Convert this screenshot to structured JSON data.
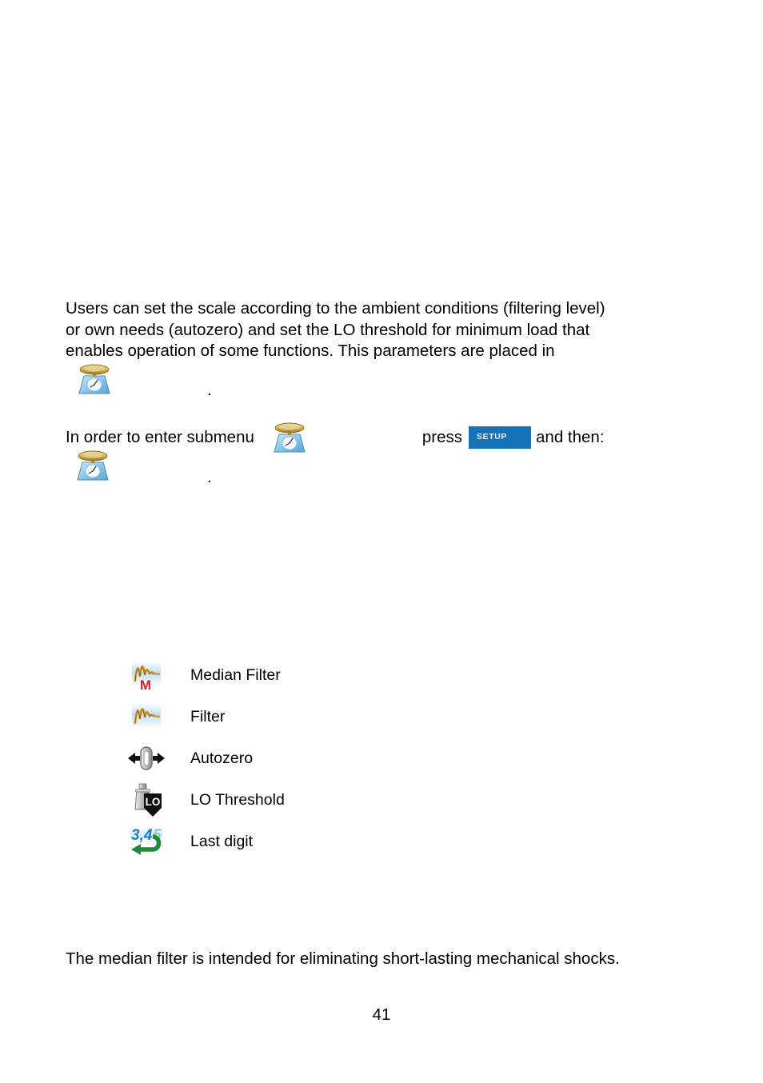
{
  "document": {
    "page_number": "41",
    "intro_paragraph": {
      "line1": "Users can set the scale according to the ambient conditions (filtering level)",
      "line2": "or own needs (autozero) and set the LO threshold for minimum load that",
      "line3": "enables operation of some functions. This parameters are placed in",
      "trailing_period": "."
    },
    "submenu_instruction": {
      "prefix": "In order to enter submenu",
      "press_word": "press",
      "suffix": "and then:",
      "trailing_period": "."
    },
    "setup_key": {
      "label": "SETUP",
      "color": "#1672b8",
      "text_color": "#eaf3fa"
    },
    "scale_icon_name": "scale-balance-icon",
    "parameters": [
      {
        "icon": "median-filter-icon",
        "label": "Median Filter"
      },
      {
        "icon": "filter-icon",
        "label": "Filter"
      },
      {
        "icon": "autozero-icon",
        "label": "Autozero"
      },
      {
        "icon": "lo-threshold-icon",
        "label": "LO Threshold"
      },
      {
        "icon": "last-digit-icon",
        "label": "Last digit"
      }
    ],
    "closing_paragraph": "The median filter is intended for eliminating short-lasting mechanical shocks.",
    "colors": {
      "text": "#000000",
      "background": "#ffffff",
      "setup_blue": "#1672b8",
      "icon_gold": "#c9a227",
      "icon_blue": "#8fc7ea",
      "waveform_orange": "#d89a2a",
      "median_red": "#e02020",
      "last_digit_blue": "#1f7fc4",
      "last_digit_green": "#1f8a3c",
      "autozero_gray": "#a8a8a8"
    }
  }
}
